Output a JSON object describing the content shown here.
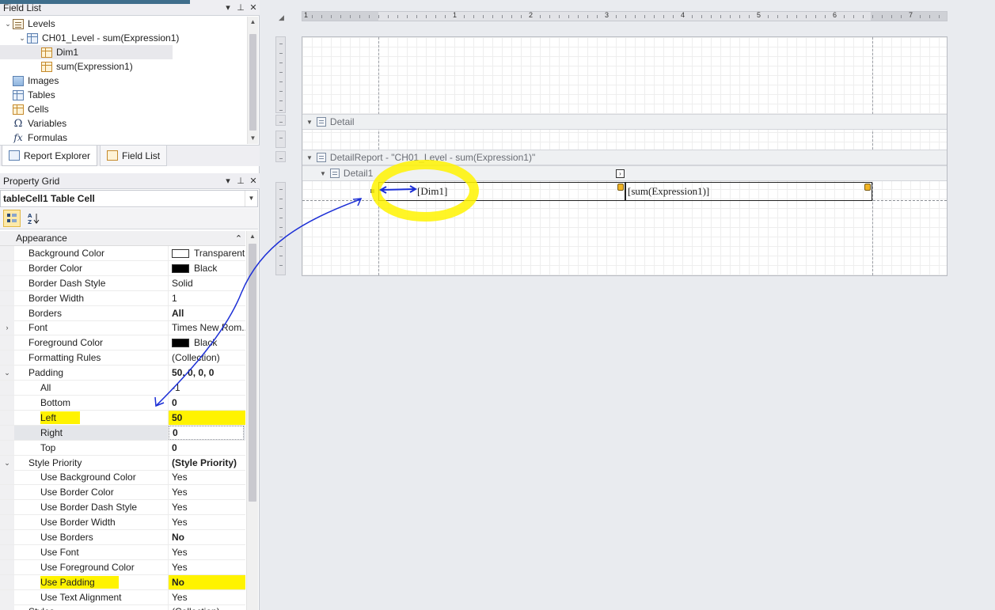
{
  "field_list": {
    "title": "Field List",
    "items": [
      {
        "label": "Levels",
        "icon": "levels-icon",
        "indent": 0,
        "expander": "expanded"
      },
      {
        "label": "CH01_Level - sum(Expression1)",
        "icon": "level-icon",
        "indent": 1,
        "expander": "expanded"
      },
      {
        "label": "Dim1",
        "icon": "field-icon",
        "indent": 2,
        "expander": "",
        "selected": true
      },
      {
        "label": "sum(Expression1)",
        "icon": "field-icon",
        "indent": 2,
        "expander": ""
      },
      {
        "label": "Images",
        "icon": "image-icon",
        "indent": 0,
        "expander": ""
      },
      {
        "label": "Tables",
        "icon": "table-icon",
        "indent": 0,
        "expander": ""
      },
      {
        "label": "Cells",
        "icon": "cells-icon",
        "indent": 0,
        "expander": ""
      },
      {
        "label": "Variables",
        "icon": "omega-icon",
        "glyph": "Ω",
        "indent": 0,
        "expander": ""
      },
      {
        "label": "Formulas",
        "icon": "function-icon",
        "glyph": "fx",
        "indent": 0,
        "expander": ""
      }
    ]
  },
  "tabs": {
    "report_explorer": "Report Explorer",
    "field_list": "Field List"
  },
  "property_grid": {
    "title": "Property Grid",
    "selected_object": "tableCell1  Table Cell",
    "rows": [
      {
        "kind": "cat",
        "name": "Appearance",
        "value": "",
        "expander": "^"
      },
      {
        "name": "Background Color",
        "value": "Transparent",
        "swatch": "#ffffff"
      },
      {
        "name": "Border Color",
        "value": "Black",
        "swatch": "#000000"
      },
      {
        "name": "Border Dash Style",
        "value": "Solid"
      },
      {
        "name": "Border Width",
        "value": "1"
      },
      {
        "name": "Borders",
        "value": "All",
        "bold": true
      },
      {
        "name": "Font",
        "value": "Times New Rom...",
        "expander": ">"
      },
      {
        "name": "Foreground Color",
        "value": "Black",
        "swatch": "#000000"
      },
      {
        "name": "Formatting Rules",
        "value": "(Collection)"
      },
      {
        "name": "Padding",
        "value": "50, 0, 0, 0",
        "bold": true,
        "expander": "v"
      },
      {
        "name": "All",
        "value": "-1",
        "sub": true
      },
      {
        "name": "Bottom",
        "value": "0",
        "sub": true,
        "bold": true
      },
      {
        "name": "Left",
        "value": "50",
        "sub": true,
        "bold": true,
        "highlight": true
      },
      {
        "name": "Right",
        "value": "0",
        "sub": true,
        "bold": true,
        "selected": true
      },
      {
        "name": "Top",
        "value": "0",
        "sub": true,
        "bold": true
      },
      {
        "name": "Style Priority",
        "value": "(Style Priority)",
        "bold": true,
        "expander": "v"
      },
      {
        "name": "Use Background Color",
        "value": "Yes",
        "sub": true
      },
      {
        "name": "Use Border Color",
        "value": "Yes",
        "sub": true
      },
      {
        "name": "Use Border Dash Style",
        "value": "Yes",
        "sub": true
      },
      {
        "name": "Use Border Width",
        "value": "Yes",
        "sub": true
      },
      {
        "name": "Use Borders",
        "value": "No",
        "sub": true,
        "bold": true
      },
      {
        "name": "Use Font",
        "value": "Yes",
        "sub": true
      },
      {
        "name": "Use Foreground Color",
        "value": "Yes",
        "sub": true
      },
      {
        "name": "Use Padding",
        "value": "No",
        "sub": true,
        "bold": true,
        "highlight": true
      },
      {
        "name": "Use Text Alignment",
        "value": "Yes",
        "sub": true
      },
      {
        "name": "Styles",
        "value": "(Collection)",
        "expander": ">"
      }
    ]
  },
  "designer": {
    "ruler_numbers": [
      "1",
      "1",
      "2",
      "3",
      "4",
      "5",
      "6",
      "7"
    ],
    "bands": {
      "detail": "Detail",
      "detail_report": "DetailReport - \"CH01_Level - sum(Expression1)\"",
      "detail1": "Detail1"
    },
    "cells": {
      "cell1": "[Dim1]",
      "cell2": "[sum(Expression1)]"
    }
  },
  "colors": {
    "highlight": "#fff300",
    "annotation_arrow": "#1c2fd6",
    "handle": "#f0b324"
  }
}
